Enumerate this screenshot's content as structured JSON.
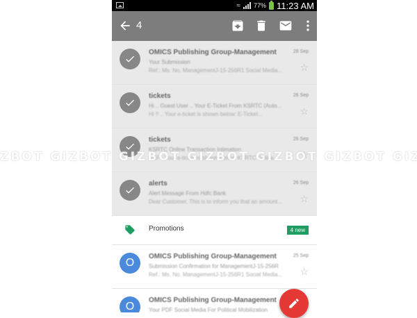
{
  "status_bar": {
    "battery": "77%",
    "time": "11:23 AM"
  },
  "action_bar": {
    "selected_count": "4"
  },
  "emails": [
    {
      "sender": "OMICS Publishing Group-Management",
      "date": "28 Sep",
      "subject": "Your Submission",
      "snippet": "Ref.: Ms. No. ManagementJ-15-256R1 Social Media...",
      "selected": true
    },
    {
      "sender": "tickets",
      "date": "26 Sep",
      "subject": "Hi .. Guest User .. Your E-Ticket From KSRTC (Auto...",
      "snippet": "Hi !! .. Your e-ticket is shown below: E-Ticket...",
      "selected": true
    },
    {
      "sender": "tickets",
      "date": "26 Sep",
      "subject": "KSRTC Online Transaction Intimation",
      "snippet": "REF : Your e-ticket is shown below: KSRTC Online...",
      "selected": true
    },
    {
      "sender": "alerts",
      "date": "26 Sep",
      "subject": "Alert Message From Hdfc Bank",
      "snippet": "Dear Customer, This is to inform you that an amount...",
      "selected": true
    }
  ],
  "promotions": {
    "label": "Promotions",
    "badge": "4 new"
  },
  "emails_after": [
    {
      "avatar": "O",
      "sender": "OMICS Publishing Group-Management",
      "date": "25 Sep",
      "subject": "Submission Confirmation for ManagementJ-15-256R",
      "snippet": "Ref.: Ms. No. ManagementJ-15-256R1 Social Media..."
    },
    {
      "avatar": "O",
      "sender": "OMICS Publishing Group-Management",
      "date": "",
      "subject": "Your PDF Social Media For Political Mobilization",
      "snippet": ""
    }
  ],
  "watermark": "ZBOT GIZBOT GIZBOT GIZBOT GIZBOT GIZBOT GIZBO",
  "colors": {
    "action_bar": "#7d7d7d",
    "fab": "#e53935",
    "promo_badge": "#1e9e61",
    "avatar_blue": "#4a89dc"
  }
}
